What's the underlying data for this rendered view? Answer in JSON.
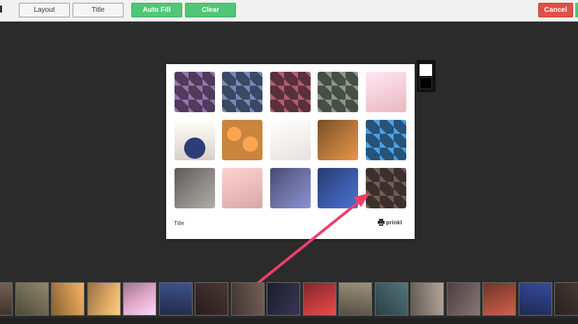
{
  "toolbar": {
    "layout_label": "Layout",
    "title_label": "Title",
    "autofill_label": "Auto Fill",
    "clear_label": "Clear",
    "cancel_label": "Cancel"
  },
  "card": {
    "title": "Title",
    "logo_text": "prinkl"
  },
  "swatches": [
    {
      "name": "white",
      "color": "#ffffff"
    },
    {
      "name": "black",
      "color": "#000000"
    }
  ],
  "colors": {
    "accent_green": "#4fc774",
    "cancel_red": "#e05045",
    "arrow_pink": "#ee3f6a",
    "background": "#2b2b2b"
  },
  "grid": [
    {
      "id": "mickey-collage-1",
      "tone": "#7a5a8a",
      "pattern": "collage"
    },
    {
      "id": "mickey-collage-2",
      "tone": "#5a6e95",
      "pattern": "collage"
    },
    {
      "id": "mickey-collage-3",
      "tone": "#8a4a5a",
      "pattern": "collage"
    },
    {
      "id": "mickey-collage-4",
      "tone": "#6b7a6a",
      "pattern": "collage"
    },
    {
      "id": "stickers",
      "tone": "#e9b8c2",
      "pattern": "soft"
    },
    {
      "id": "mug",
      "tone": "#d9cfc8",
      "pattern": "mug"
    },
    {
      "id": "cookies",
      "tone": "#c9843e",
      "pattern": "cookies"
    },
    {
      "id": "cat-figure",
      "tone": "#e8e2de",
      "pattern": "soft"
    },
    {
      "id": "scissors",
      "tone": "#b8783a",
      "pattern": "dark"
    },
    {
      "id": "tsum-grid",
      "tone": "#3c7fb7",
      "pattern": "collage"
    },
    {
      "id": "black-cat",
      "tone": "#8d8a86",
      "pattern": "dark"
    },
    {
      "id": "ice-cream",
      "tone": "#d6a8a8",
      "pattern": "soft"
    },
    {
      "id": "arcade",
      "tone": "#6f74a8",
      "pattern": "dark"
    },
    {
      "id": "anime-poster",
      "tone": "#3b5aa8",
      "pattern": "dark"
    },
    {
      "id": "cosplay-collage",
      "tone": "#5b4a44",
      "pattern": "collage"
    }
  ],
  "filmstrip": [
    {
      "tone": "#5a4a40"
    },
    {
      "tone": "#6f6a52"
    },
    {
      "tone": "#c08a4a"
    },
    {
      "tone": "#d4a060"
    },
    {
      "tone": "#e0a6c8"
    },
    {
      "tone": "#2f3f6a"
    },
    {
      "tone": "#3a2a28"
    },
    {
      "tone": "#5b4a44"
    },
    {
      "tone": "#2a2a40"
    },
    {
      "tone": "#b8383a"
    },
    {
      "tone": "#7a7060"
    },
    {
      "tone": "#3e5a60"
    },
    {
      "tone": "#8a8078"
    },
    {
      "tone": "#6a5a5a"
    },
    {
      "tone": "#a04a3a"
    },
    {
      "tone": "#2a3a78"
    },
    {
      "tone": "#3a2f2a"
    }
  ]
}
